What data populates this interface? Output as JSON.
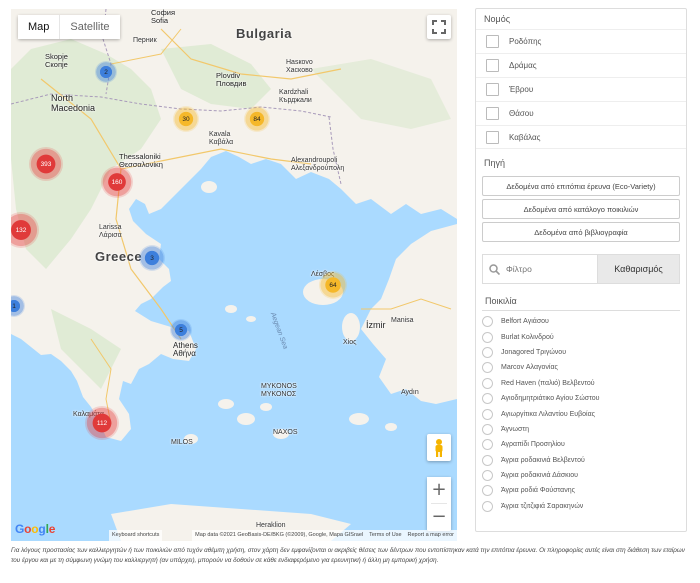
{
  "map": {
    "type_buttons": [
      "Map",
      "Satellite"
    ],
    "labels": {
      "country_bulgaria": "Bulgaria",
      "country_greece": "Greece",
      "sea_aegean": "Aegean Sea",
      "sofia": "София\nSofia",
      "skopje": "Skopje\nСкопје",
      "north_macedonia": "North\nMacedonia",
      "plovdiv": "Plovdiv\nПловдив",
      "pernik": "Перник",
      "haskovo": "Hasкovo\nХасково",
      "kardzhali": "Kardzhali\nКърджали",
      "thessaloniki": "Thessaloniki\nΘεσσαλονίκη",
      "alexandroupoli": "Alexandroupoli\nΑλεξανδρούπολη",
      "kavala": "Kavala\nΚαβάλα",
      "larissa": "Larissa\nΛάρισα",
      "athens": "Athens\nΑθήνα",
      "kalamata": "Καλαμάτα",
      "izmir": "İzmir",
      "manisa": "Manisa",
      "aydin": "Aydın",
      "mykonos": "MYKONOS\nΜΥΚΟΝΟΣ",
      "naxos": "NAXOS",
      "heraklion": "Heraklion",
      "milos": "MILOS",
      "chios": "Χίος",
      "lesvos": "Λέσβος"
    },
    "clusters": [
      {
        "label": "2",
        "color": "blue"
      },
      {
        "label": "30",
        "color": "yellow"
      },
      {
        "label": "84",
        "color": "yellow"
      },
      {
        "label": "393",
        "color": "red"
      },
      {
        "label": "160",
        "color": "red"
      },
      {
        "label": "132",
        "color": "red"
      },
      {
        "label": "3",
        "color": "blue"
      },
      {
        "label": "64",
        "color": "yellow"
      },
      {
        "label": "5",
        "color": "blue"
      },
      {
        "label": "1",
        "color": "blue"
      },
      {
        "label": "112",
        "color": "red"
      }
    ],
    "google_logo": "Google",
    "attribution": {
      "shortcuts": "Keyboard shortcuts",
      "data": "Map data ©2021 GeoBasis-DE/BKG (©2009), Google, Mapa GISrael",
      "terms": "Terms of Use",
      "report": "Report a map error"
    },
    "zoom_in": "+",
    "zoom_out": "−"
  },
  "panel": {
    "prefecture_title": "Νομός",
    "prefectures": [
      "Ροδόπης",
      "Δράμας",
      "Έβρου",
      "Θάσου",
      "Καβάλας"
    ],
    "source_title": "Πηγή",
    "sources": [
      "Δεδομένα από επιτόπια έρευνα (Eco-Variety)",
      "Δεδομένα από κατάλογο ποικιλιών",
      "Δεδομένα από βιβλιογραφία"
    ],
    "filter_placeholder": "Φίλτρο",
    "clear_label": "Καθαρισμός",
    "variety_title": "Ποικιλία",
    "varieties": [
      "Belfort Αγιάσου",
      "Burlat Κολινδρού",
      "Jonagored Τριγώνου",
      "Marcov Αλαγονίας",
      "Red Haven (παλιό) Βελβεντού",
      "Αγιοδημητριάτικο Αγίου Σώστου",
      "Αγιωργίτικα Λιλαντίου Ευβοίας",
      "Άγνωστη",
      "Αγραπίδι Προσηλίου",
      "Άγρια ροδακινιά Βελβεντού",
      "Άγρια ροδακινιά Δάσκιου",
      "Άγρια ροδιά Φούστανης",
      "Άγρια τζιτζιφιά Σαρακηνών"
    ]
  },
  "note": "Για λόγους προστασίας των καλλιεργητών ή των ποικιλιών από τυχόν αθέμιτη χρήση, στον χάρτη δεν εμφανίζονται οι ακριβείς θέσεις των δέντρων που εντοπίστηκαν κατά την επιτόπια έρευνα. Οι πληροφορίες αυτές είναι στη διάθεση των εταίρων του έργου και με τη σύμφωνη γνώμη του καλλιεργητή (αν υπάρχει), μπορούν να δοθούν σε κάθε ενδιαφερόμενο για ερευνητική ή άλλη μη εμπορική χρήση."
}
